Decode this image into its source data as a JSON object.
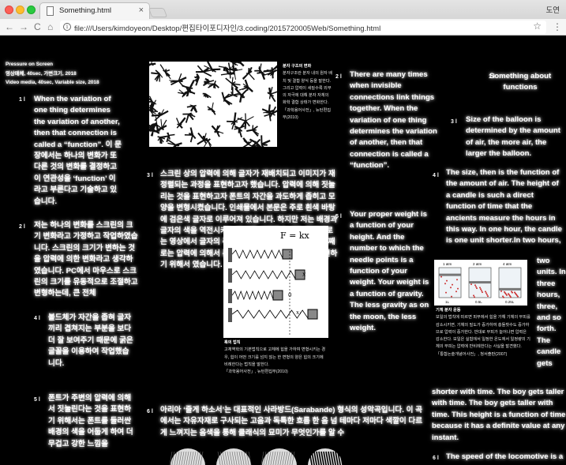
{
  "browser": {
    "tab_title": "Something.html",
    "tab_close": "×",
    "profile_name": "도연",
    "url": "file:///Users/kimdoyeon/Desktop/편집타이포디자인/3.coding/2015720005Web/Something.html",
    "nav": {
      "back": "←",
      "forward": "→",
      "reload": "C",
      "home": "⌂",
      "star": "☆",
      "menu": "⋮",
      "info": "i"
    }
  },
  "meta": {
    "line1": "Pressure on Screen",
    "line2": "영상매체, 40sec, 가변크기, 2018",
    "line3": "Video media, 40sec, Variable size, 2018"
  },
  "col1": {
    "n1": "1 l",
    "p1": "When the variation of one thing determines the variation of another, then that connection is called a “function”. 이 문장에서는 하나의 변화가 또 다른 것의 변화를 결정하고 이 연관성을 ‘function’ 이라고 부른다고 기술하고 있습니다.",
    "n2": "2 l",
    "p2": "저는 하나의 변화를 스크린의 크기 변화라고 가정하고 작업하였습니다. 스크린의 크기가 변하는 것을 압력에 의한 변화라고 생각하였습니다. PC에서 마우스로 스크린의 크기를 유동적으로 조절하고 변형하는데, 큰 전체",
    "n4": "4 l",
    "p4": "볼드체가 자간을 좁혀 글자끼리 겹쳐지는 부분을 보다 더 잘 보여주기 때문에 굵은 글꼴을 이용하여 작업했습니다.",
    "n5": "5 l",
    "p5": "폰트가 주변의 압력에 의해서 짓눌린다는 것을 표현하기 위해서는 폰트를 둘러싼 배경의 색을 어둡게 하여 더 무겁고 강한 느낌을"
  },
  "col2": {
    "n3": "3 l",
    "p3": "스크린 상의 압력에 의해 글자가 재배치되고 이미지가 재정렬되는 과정을 표현하고자 했습니다. 압력에 의해 짓눌리는 것을 표현하고자 폰트의 자간을 과도하게 좁히고 모양을 변형시켰습니다. 인쇄물에서 본문은 주로 흰색 바탕에 검은색 글자로 이루어져 있습니다. 하지만 저는 배경과 글자의 색을 역전시키는 방식을 선택했습니다. 첫번째로는 영상에서 글자의 주목성을 높이기 위함이었고, 두번째로는 압력에 의해서 폰트가 변형된다는 것을 더 잘 표현하기 위해서 였습니다.",
    "n6": "6 l",
    "p6": "아리아 ‘줄게 하소서’는 대표적인 사라방드(Sarabande) 형식의 성악곡입니다. 이 곡에서는 자유자재로 구사되는 고음과 독특한 흐름 한 음 넘 테마다 저마다 색깔이 다르게 느껴지는 음색을 통해 클래식의 묘미가 무엇인가를 알 수"
  },
  "caption1": {
    "title": "분자 구조의 변화",
    "body": "분자구조란 분자 내의 원자 배치 및 결합 양식 등을 말한다. 그리고 압력이 세질수록 외부의 자극에 대해 분자 자체의 화학 결합 상태가 변화한다.",
    "source": "「과학용어사전」, 뉴턴편집부(2010)"
  },
  "caption2": {
    "title": "훅의 법칙",
    "body": "고체역학의 기본법칙으로 고체에 힘을 가하여 변형시키는 경우, 힘이 어떤 크기를 넘지 않는 한 변형의 양은 힘의 크기에 비례한다는 법칙을 말한다.",
    "source": "「과학용어사전」, 뉴턴편집부(2010)"
  },
  "col3": {
    "n2": "2 l",
    "p2": "There are many times when invisible connections link things together. When the variation of one thing determines the variation of another, then that connection is called a “function”.",
    "n5": "5 l",
    "p5": "Your proper weight is a function of your height. And the number to which the needle points is a function of your weight. Your weight is a function of gravity. The less gravity as on the moon, the less weight."
  },
  "col4": {
    "n1": "1 l",
    "p1": "Something about functions",
    "n3": "3 l",
    "p3": "Size of the balloon is determined by the amount of air, the more air, the larger the balloon.",
    "n4": "4 l",
    "p4": "The size, then is the function of the amount of air. The height of a candle is such a direct function of time that the ancients measure the hours in this way. In one hour, the candle is one unit shorter.In two hours,",
    "p4b": "two units. In three hours, three, and so forth. The candle gets",
    "p4c": "shorter with time. The boy gets taller with time. The boy gets taller with time. This height is a function of time because it has a definite value at any instant.",
    "n6": "6 l",
    "p6": "The speed of the locomotive is a"
  },
  "caption3": {
    "title": "기체 분자 운동",
    "body": "보일의 법칙에 따르면 피부에서 힘을 가해 기체의 부피를 감소시키면, 기체의 밀도가 증가하여 충돌횟수도 증가하므로 압력이 증가한다. 반대로 부피가 늘어나면 압력은 감소한다. 보일은 실험에서 일정한 온도에서 일정량의 기체의 부피는 압력에 반비례한다는 사실을 발견했다.",
    "source": "「통합논술개념어사전」, 청서출판(2007)"
  },
  "figures": {
    "hooke_formula": "F = kx",
    "hooke_label_x": "x",
    "hooke_label_0": "0",
    "hooke_label_xs": "x₁",
    "balloon_labels": [
      "1 atm",
      "2 atm",
      "4 atm"
    ],
    "balloon_pct": [
      "1L",
      "0.5L",
      "0.25L"
    ]
  }
}
